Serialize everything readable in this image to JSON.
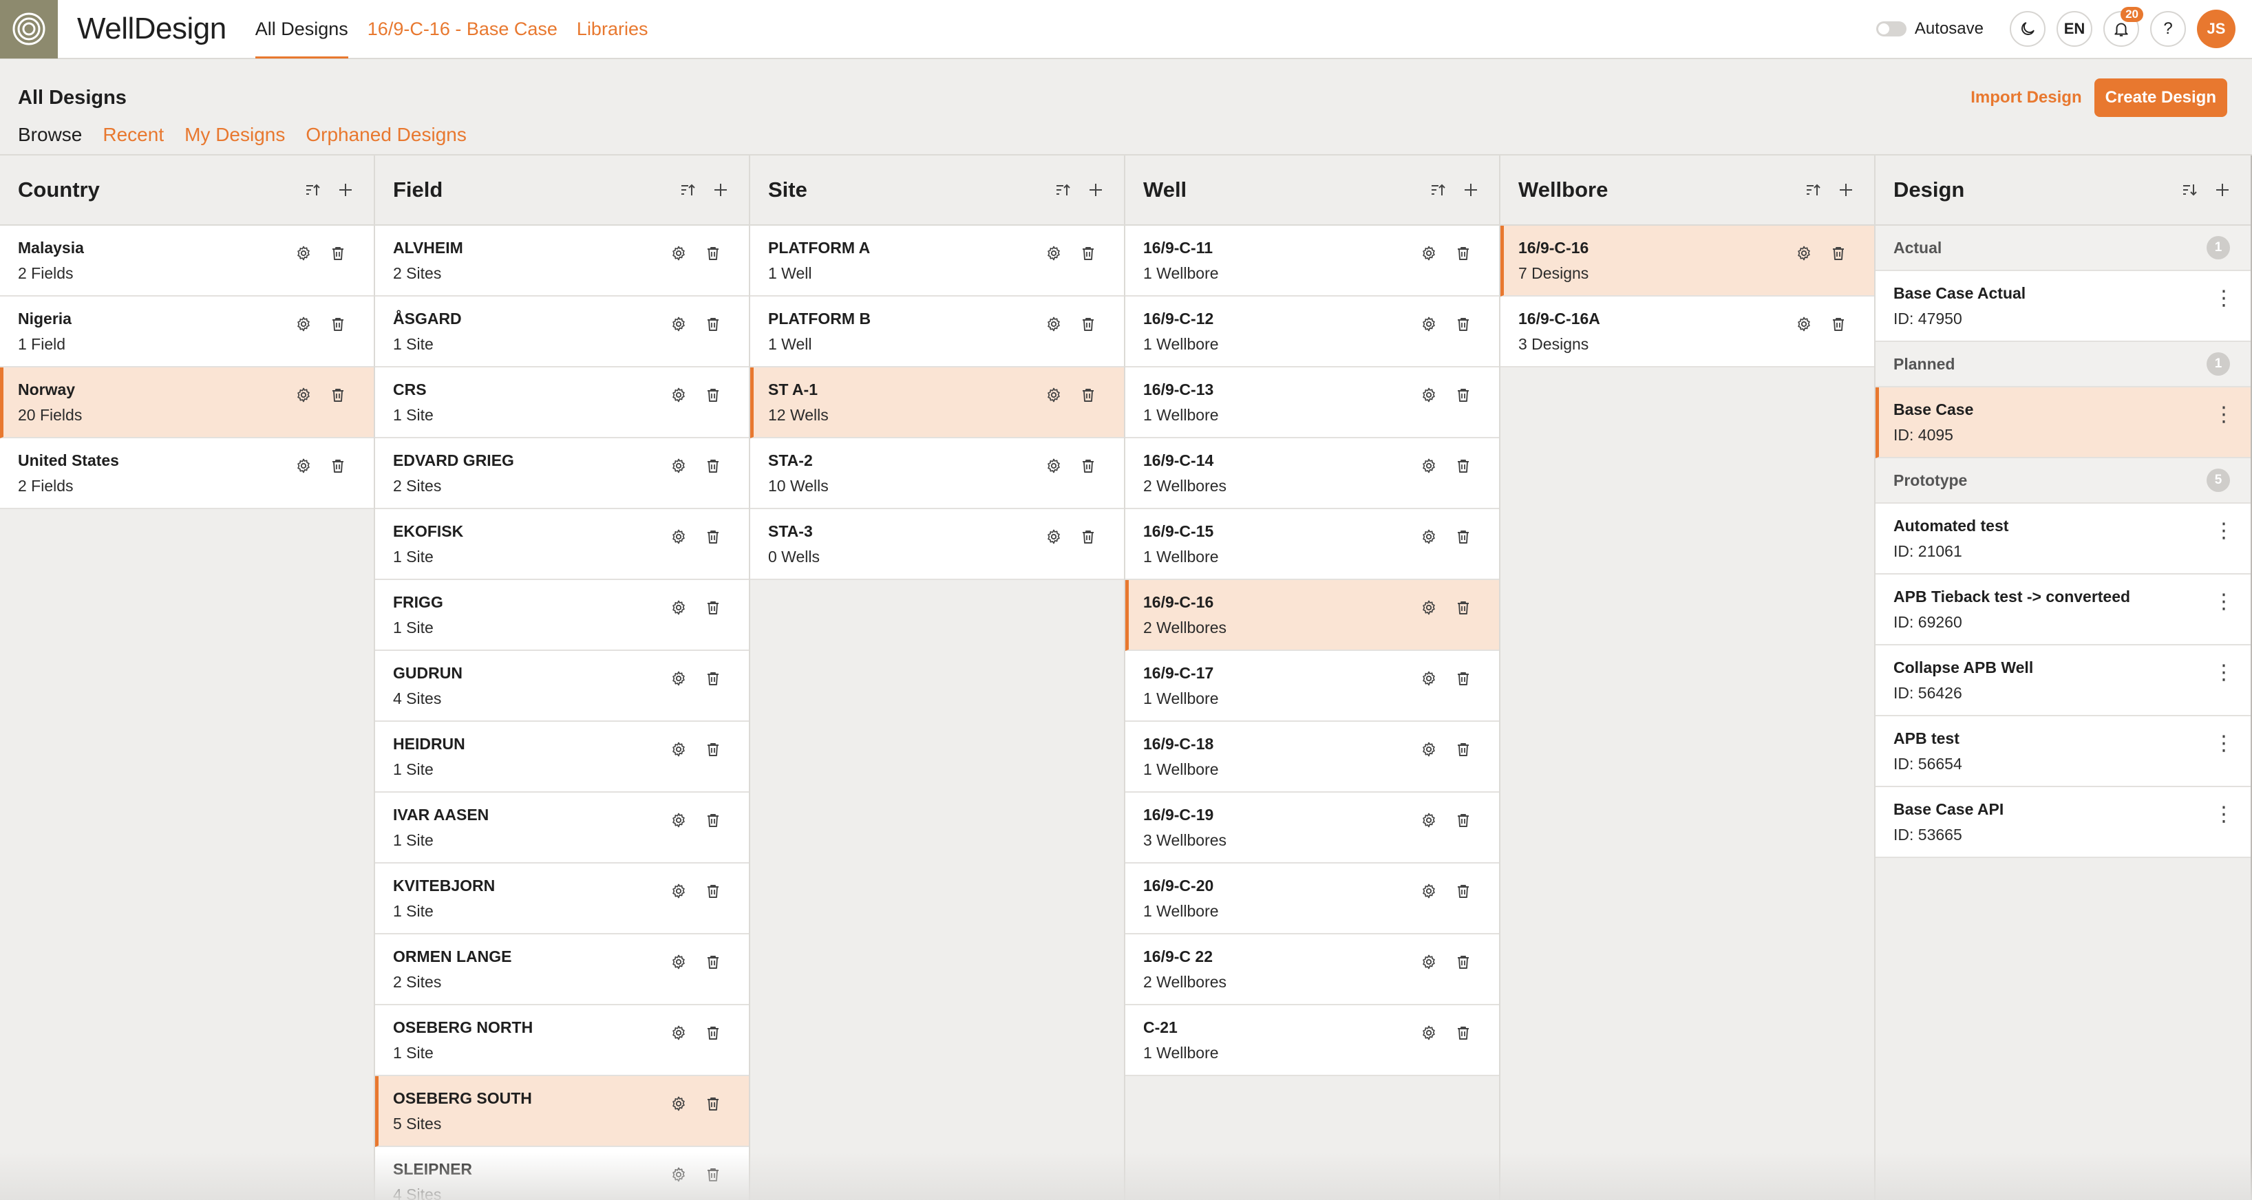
{
  "app": {
    "brand": "WellDesign",
    "nav": [
      {
        "label": "All Designs"
      },
      {
        "label": "16/9-C-16 - Base Case"
      },
      {
        "label": "Libraries"
      }
    ],
    "autosave_label": "Autosave",
    "language": "EN",
    "notification_count": "20",
    "help": "?",
    "avatar_initials": "JS",
    "accent_color": "#e8782f"
  },
  "page": {
    "title": "All Designs",
    "tabs": [
      {
        "label": "Browse"
      },
      {
        "label": "Recent"
      },
      {
        "label": "My Designs"
      },
      {
        "label": "Orphaned Designs"
      }
    ],
    "import_label": "Import Design",
    "create_label": "Create Design"
  },
  "columns": {
    "country": {
      "title": "Country",
      "items": [
        {
          "name": "Malaysia",
          "sub": "2 Fields"
        },
        {
          "name": "Nigeria",
          "sub": "1 Field"
        },
        {
          "name": "Norway",
          "sub": "20 Fields"
        },
        {
          "name": "United States",
          "sub": "2 Fields"
        }
      ]
    },
    "field": {
      "title": "Field",
      "items": [
        {
          "name": "ALVHEIM",
          "sub": "2 Sites"
        },
        {
          "name": "ÅSGARD",
          "sub": "1 Site"
        },
        {
          "name": "CRS",
          "sub": "1 Site"
        },
        {
          "name": "EDVARD GRIEG",
          "sub": "2 Sites"
        },
        {
          "name": "EKOFISK",
          "sub": "1 Site"
        },
        {
          "name": "FRIGG",
          "sub": "1 Site"
        },
        {
          "name": "GUDRUN",
          "sub": "4 Sites"
        },
        {
          "name": "HEIDRUN",
          "sub": "1 Site"
        },
        {
          "name": "IVAR AASEN",
          "sub": "1 Site"
        },
        {
          "name": "KVITEBJORN",
          "sub": "1 Site"
        },
        {
          "name": "ORMEN LANGE",
          "sub": "2 Sites"
        },
        {
          "name": "OSEBERG NORTH",
          "sub": "1 Site"
        },
        {
          "name": "OSEBERG SOUTH",
          "sub": "5 Sites"
        },
        {
          "name": "SLEIPNER",
          "sub": "4 Sites"
        }
      ]
    },
    "site": {
      "title": "Site",
      "items": [
        {
          "name": "PLATFORM A",
          "sub": "1 Well"
        },
        {
          "name": "PLATFORM B",
          "sub": "1 Well"
        },
        {
          "name": "ST A-1",
          "sub": "12 Wells"
        },
        {
          "name": "STA-2",
          "sub": "10 Wells"
        },
        {
          "name": "STA-3",
          "sub": "0 Wells"
        }
      ]
    },
    "well": {
      "title": "Well",
      "items": [
        {
          "name": "16/9-C-11",
          "sub": "1 Wellbore"
        },
        {
          "name": "16/9-C-12",
          "sub": "1 Wellbore"
        },
        {
          "name": "16/9-C-13",
          "sub": "1 Wellbore"
        },
        {
          "name": "16/9-C-14",
          "sub": "2 Wellbores"
        },
        {
          "name": "16/9-C-15",
          "sub": "1 Wellbore"
        },
        {
          "name": "16/9-C-16",
          "sub": "2 Wellbores"
        },
        {
          "name": "16/9-C-17",
          "sub": "1 Wellbore"
        },
        {
          "name": "16/9-C-18",
          "sub": "1 Wellbore"
        },
        {
          "name": "16/9-C-19",
          "sub": "3 Wellbores"
        },
        {
          "name": "16/9-C-20",
          "sub": "1 Wellbore"
        },
        {
          "name": "16/9-C 22",
          "sub": "2 Wellbores"
        },
        {
          "name": "C-21",
          "sub": "1 Wellbore"
        }
      ]
    },
    "wellbore": {
      "title": "Wellbore",
      "items": [
        {
          "name": "16/9-C-16",
          "sub": "7 Designs"
        },
        {
          "name": "16/9-C-16A",
          "sub": "3 Designs"
        }
      ]
    },
    "design": {
      "title": "Design",
      "groups": [
        {
          "name": "Actual",
          "count": "1",
          "items": [
            {
              "name": "Base Case Actual",
              "sub": "ID: 47950"
            }
          ]
        },
        {
          "name": "Planned",
          "count": "1",
          "items": [
            {
              "name": "Base Case",
              "sub": "ID: 4095"
            }
          ]
        },
        {
          "name": "Prototype",
          "count": "5",
          "items": [
            {
              "name": "Automated test",
              "sub": "ID: 21061"
            },
            {
              "name": "APB Tieback test -> converteed",
              "sub": "ID: 69260"
            },
            {
              "name": "Collapse APB Well",
              "sub": "ID: 56426"
            },
            {
              "name": "APB test",
              "sub": "ID: 56654"
            },
            {
              "name": "Base Case API",
              "sub": "ID: 53665"
            }
          ]
        }
      ]
    }
  }
}
